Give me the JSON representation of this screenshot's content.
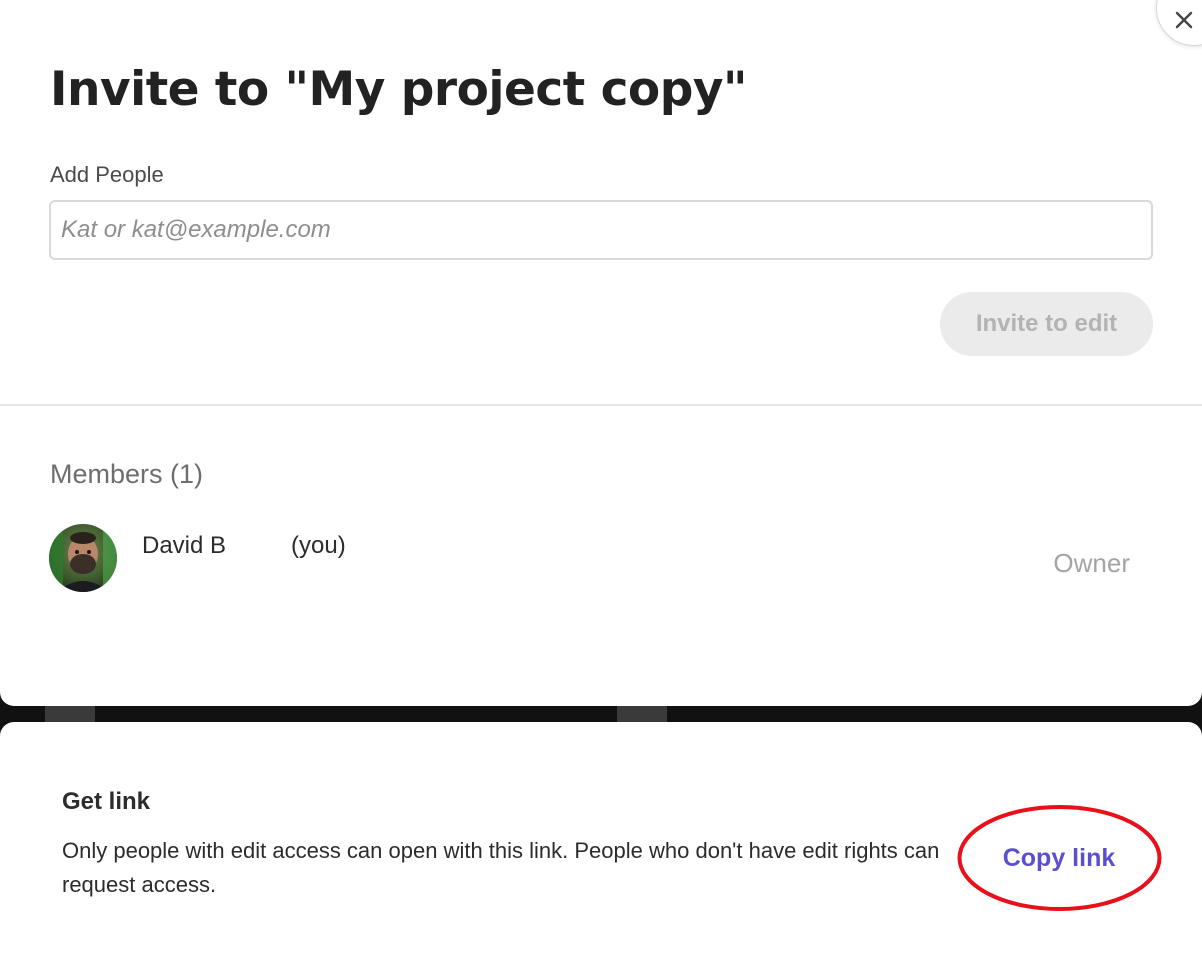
{
  "dialog": {
    "title": "Invite to \"My project copy\"",
    "add_people_label": "Add People",
    "add_people_placeholder": "Kat or kat@example.com",
    "add_people_value": "",
    "invite_button_label": "Invite to edit",
    "invite_button_state": "disabled",
    "close_icon": "close-icon"
  },
  "members": {
    "heading": "Members (1)",
    "list": [
      {
        "name": "David B",
        "you_label": "(you)",
        "role": "Owner",
        "avatar_icon": "avatar"
      }
    ]
  },
  "link_section": {
    "heading": "Get link",
    "description": "Only people with edit access can open with this link. People who don't have edit rights can request access.",
    "copy_button_label": "Copy link"
  },
  "colors": {
    "accent": "#5a4fcf",
    "highlight_ring": "#e8101a",
    "disabled_button_bg": "#ebebeb",
    "disabled_button_text": "#b3b3b3",
    "role_text": "#a4a4a4"
  }
}
